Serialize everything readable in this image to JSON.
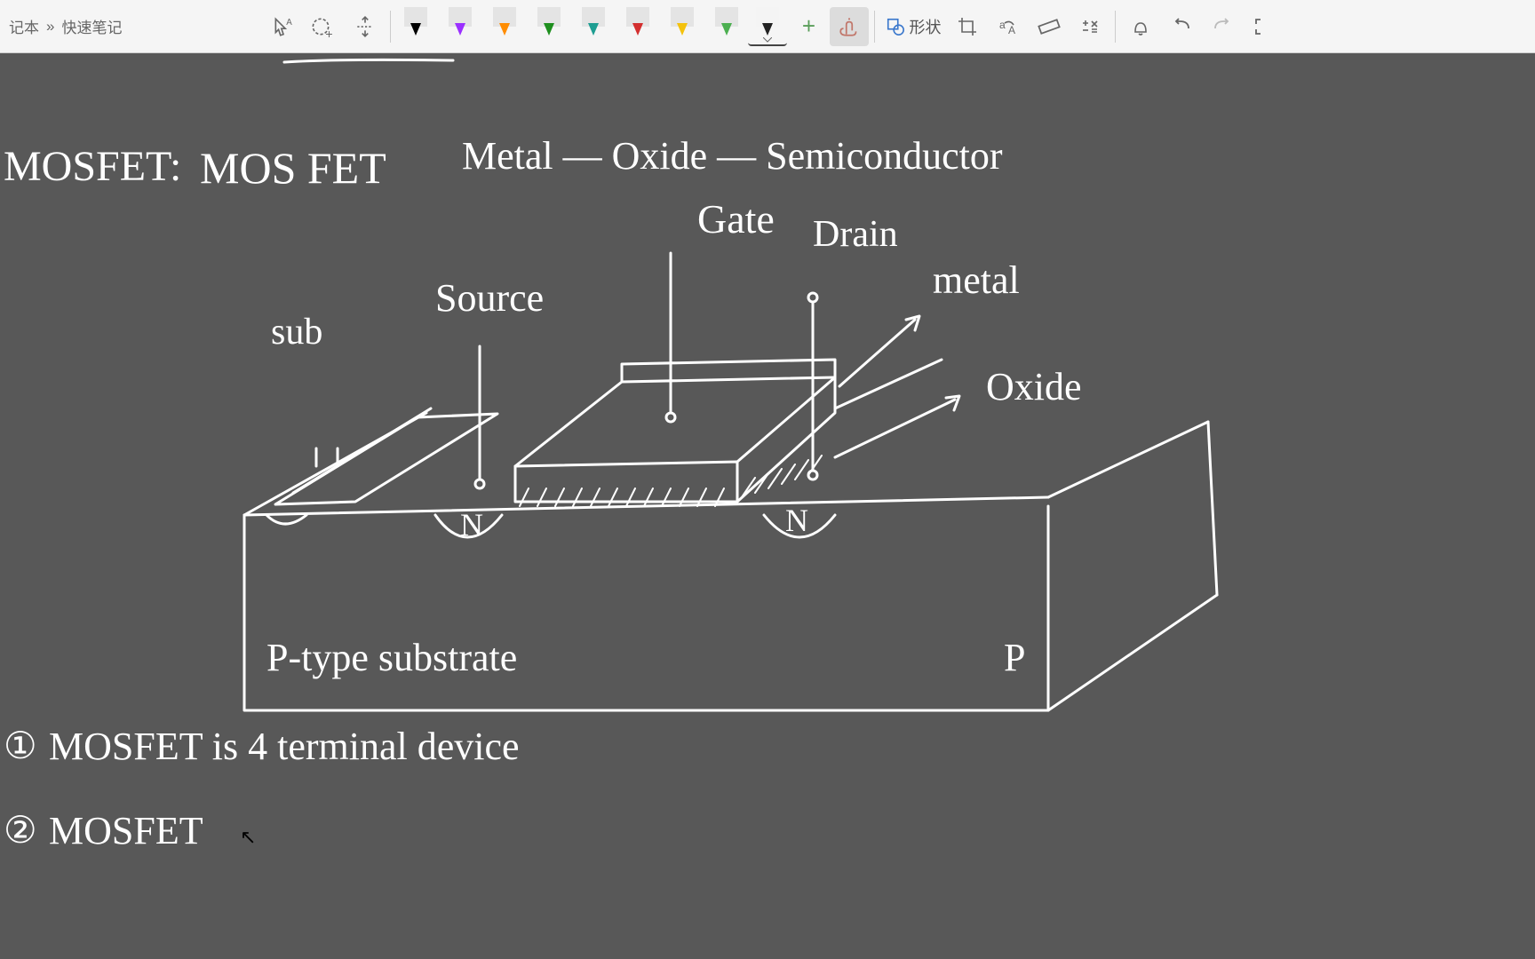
{
  "breadcrumb": {
    "notebook": "记本",
    "sep": "»",
    "note": "快速笔记"
  },
  "toolbar": {
    "shapes_label": "形状",
    "pens": [
      {
        "name": "black",
        "color": "#000000"
      },
      {
        "name": "purple",
        "color": "#9b30ff"
      },
      {
        "name": "orange",
        "color": "#ff8c00"
      },
      {
        "name": "green",
        "color": "#1e8f1e"
      },
      {
        "name": "teal",
        "color": "#1e9e92"
      },
      {
        "name": "red",
        "color": "#d32f2f"
      },
      {
        "name": "yellow",
        "color": "#f4c20d"
      },
      {
        "name": "lime",
        "color": "#4caf50"
      }
    ],
    "current_pen": "black-thin"
  },
  "handwriting": {
    "title_left": "MOSFET:",
    "title_mid": "MOS FET",
    "title_right": "Metal — Oxide — Semiconductor",
    "label_gate": "Gate",
    "label_drain": "Drain",
    "label_source": "Source",
    "label_sub": "sub",
    "label_metal": "metal",
    "label_oxide": "Oxide",
    "label_ptype": "P-type substrate",
    "label_P": "P",
    "label_N1": "N",
    "label_N2": "N",
    "note1_prefix": "①",
    "note1": "MOSFET  is  4  terminal  device",
    "note2_prefix": "②",
    "note2": "MOSFET"
  }
}
